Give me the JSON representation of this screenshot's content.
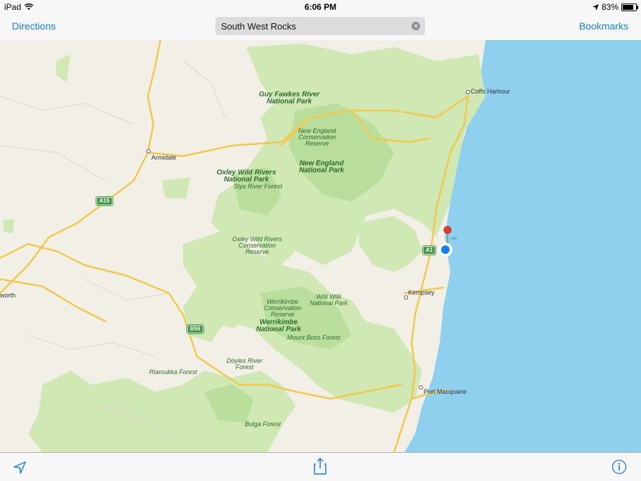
{
  "status_bar": {
    "device": "iPad",
    "time": "6:06 PM",
    "battery": "83%"
  },
  "nav": {
    "directions_label": "Directions",
    "search_value": "South West Rocks",
    "bookmarks_label": "Bookmarks"
  },
  "map": {
    "labels": [
      "Guy Fawkes River",
      "National Park",
      "New England",
      "Conservation",
      "Reserve",
      "New England",
      "National Park",
      "Oxley Wild Rivers",
      "National Park",
      "Styx River Forest",
      "Oxley Wild Rivers",
      "Conservation",
      "Reserve",
      "Willi Willi",
      "National Park",
      "Werrikimbe",
      "Conservation",
      "Reserve",
      "Werrikimbe",
      "National Park",
      "Mount Boss Forest",
      "Doyles River",
      "Forest",
      "Riamukka Forest",
      "Bulga Forest"
    ],
    "towns": [
      "Coffs Harbour",
      "Armidale",
      "Kempsey",
      "Port Macquarie",
      "worth"
    ],
    "shields": [
      "A15",
      "A1",
      "B56"
    ],
    "colors": {
      "land": "#f2efe6",
      "park": "#cfe8b4",
      "park_dark": "#a9d58c",
      "water": "#8fd0ee",
      "road": "#f2c94c"
    }
  }
}
